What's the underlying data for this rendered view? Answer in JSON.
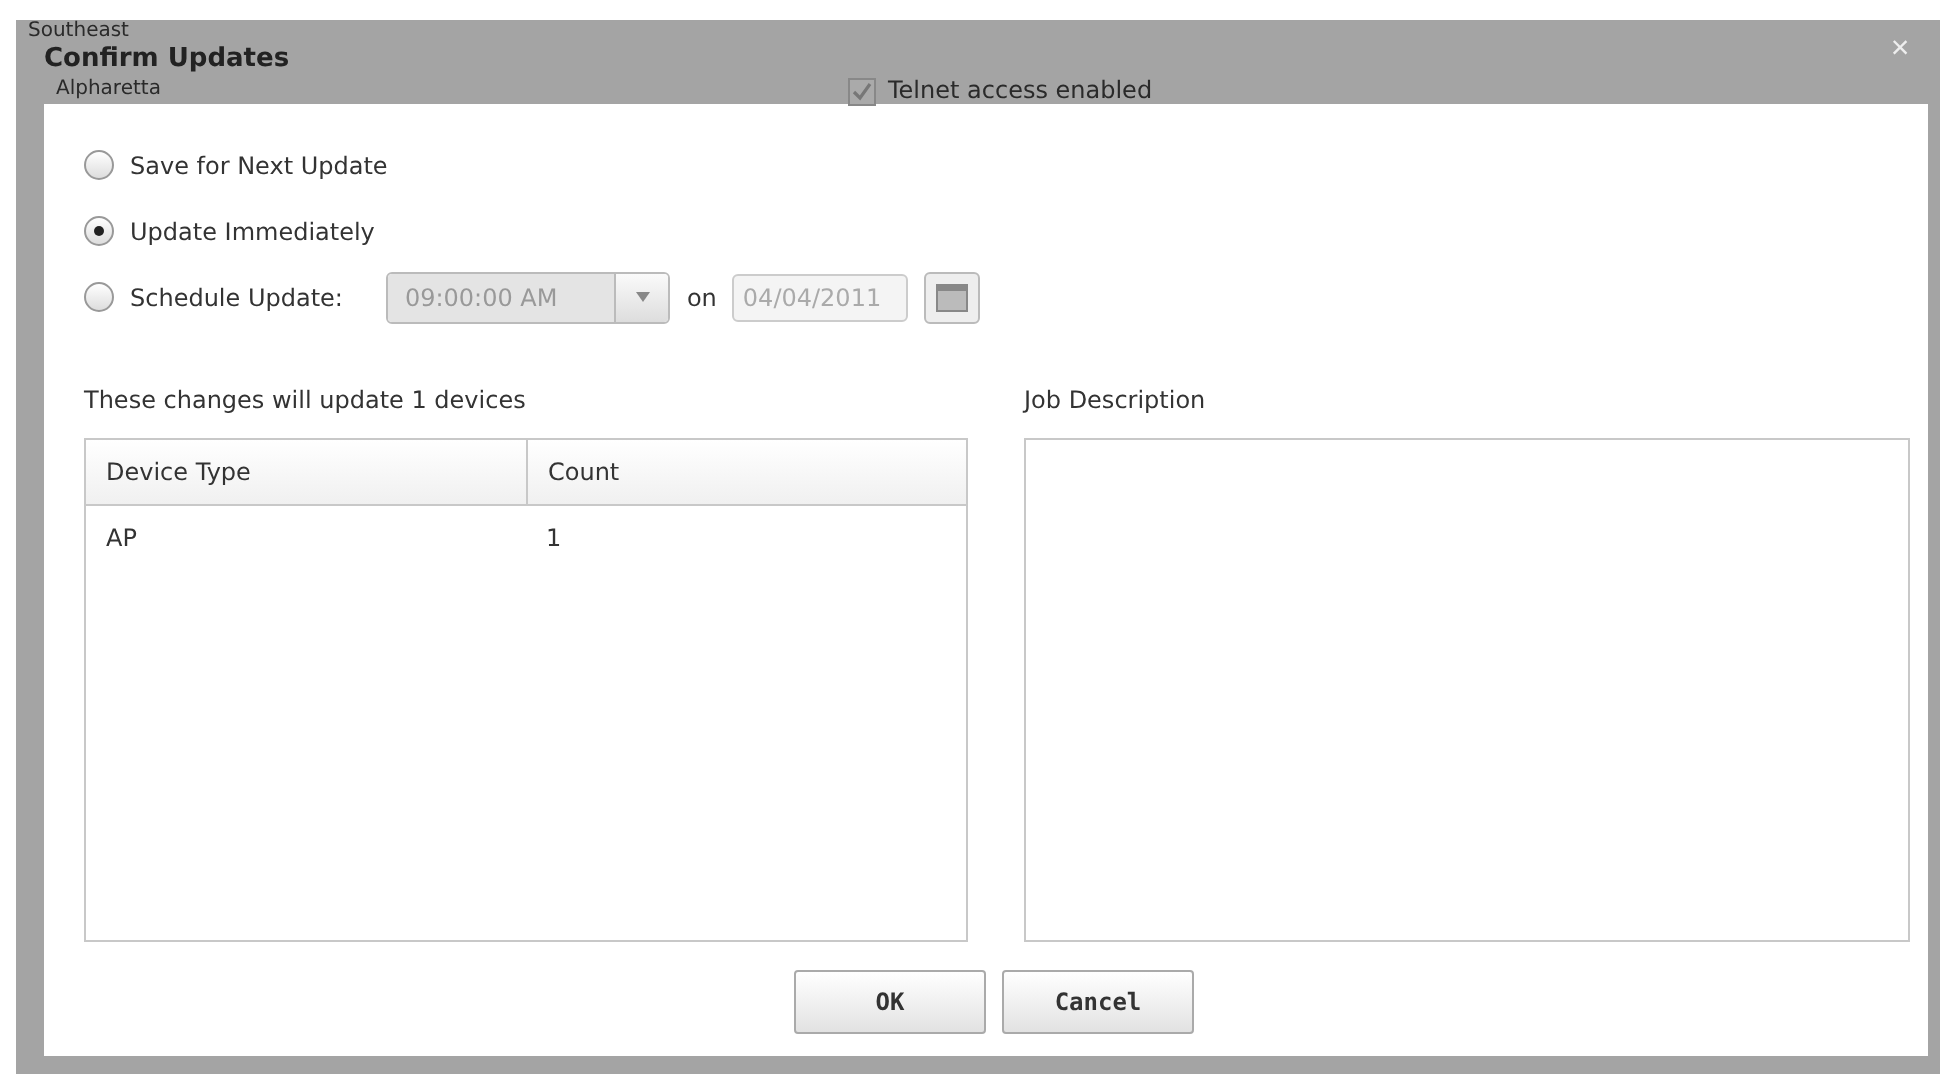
{
  "background": {
    "texts": [
      "Southeast",
      "Alpharetta"
    ],
    "option": {
      "label": "Telnet access enabled",
      "checked": true
    }
  },
  "dialog": {
    "title": "Confirm Updates",
    "close": "×"
  },
  "update_options": [
    {
      "kind": "plain",
      "label": "Save for Next Update",
      "selected": false
    },
    {
      "kind": "plain",
      "label": "Update Immediately",
      "selected": true
    },
    {
      "kind": "schedule",
      "label": "Schedule Update:",
      "selected": false,
      "time": "09:00:00 AM",
      "on_label": "on",
      "date": "04/04/2011",
      "disabled": true
    }
  ],
  "devices": {
    "summary": "These changes will update 1 devices",
    "columns": [
      "Device Type",
      "Count"
    ],
    "rows": [
      [
        "AP",
        "1"
      ]
    ]
  },
  "job_description": {
    "label": "Job Description"
  },
  "buttons": [
    "OK",
    "Cancel"
  ]
}
